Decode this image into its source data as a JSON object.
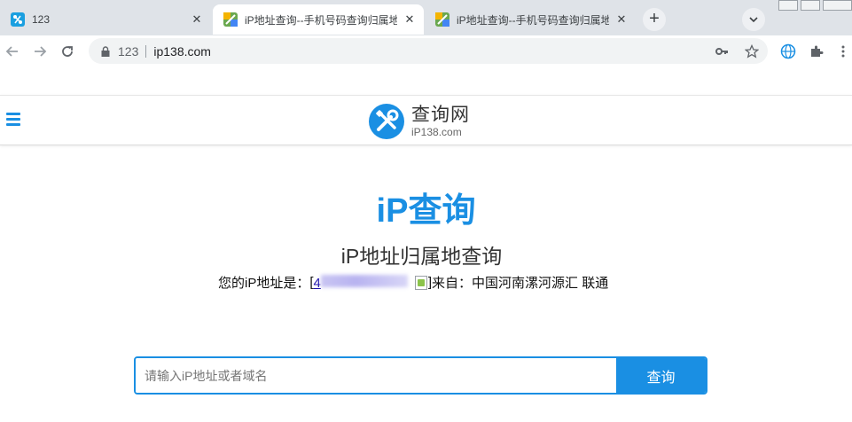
{
  "browser": {
    "tabs": [
      {
        "title": "123",
        "close": "✕",
        "active": false
      },
      {
        "title": "iP地址查询--手机号码查询归属地",
        "close": "✕",
        "active": true
      },
      {
        "title": "iP地址查询--手机号码查询归属地",
        "close": "✕",
        "active": false
      }
    ],
    "new_tab": "+",
    "address": {
      "prefix": "123",
      "url": "ip138.com"
    }
  },
  "site": {
    "logo_cn": "查询网",
    "logo_en": "iP138.com",
    "hero_title": "iP查询",
    "sub_title": "iP地址归属地查询",
    "ip_info": {
      "prefix": "您的iP地址是：",
      "bracket_open": "[",
      "ip_visible": "4",
      "bracket_close": "]",
      "from_label": "来自：中国河南漯河源汇 联通"
    },
    "search": {
      "placeholder": "请输入iP地址或者域名",
      "button": "查询"
    }
  },
  "colors": {
    "accent": "#1a8fe3",
    "tabstrip": "#dfe3e8"
  }
}
